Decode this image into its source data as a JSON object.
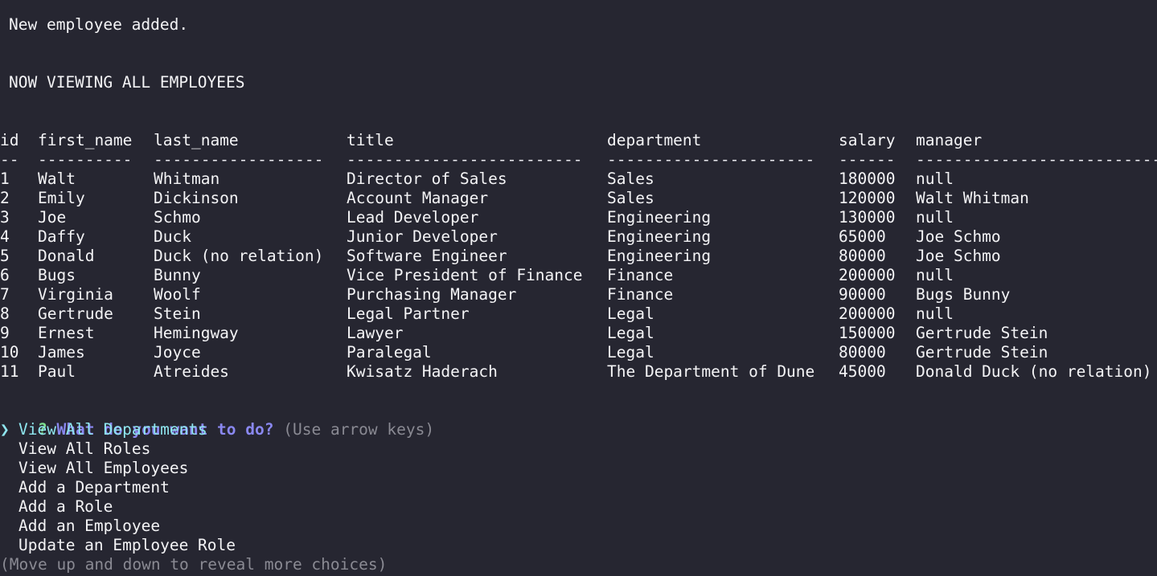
{
  "messages": {
    "added": "New employee added.",
    "viewing": "NOW VIEWING ALL EMPLOYEES"
  },
  "table": {
    "headers": [
      "id",
      "first_name",
      "last_name",
      "title",
      "department",
      "salary",
      "manager"
    ],
    "separators": [
      "--",
      "----------",
      "------------------",
      "-------------------------",
      "----------------------",
      "------",
      "---------------------------"
    ],
    "rows": [
      [
        "1",
        "Walt",
        "Whitman",
        "Director of Sales",
        "Sales",
        "180000",
        "null"
      ],
      [
        "2",
        "Emily",
        "Dickinson",
        "Account Manager",
        "Sales",
        "120000",
        "Walt Whitman"
      ],
      [
        "3",
        "Joe",
        "Schmo",
        "Lead Developer",
        "Engineering",
        "130000",
        "null"
      ],
      [
        "4",
        "Daffy",
        "Duck",
        "Junior Developer",
        "Engineering",
        "65000",
        "Joe Schmo"
      ],
      [
        "5",
        "Donald",
        "Duck (no relation)",
        "Software Engineer",
        "Engineering",
        "80000",
        "Joe Schmo"
      ],
      [
        "6",
        "Bugs",
        "Bunny",
        "Vice President of Finance",
        "Finance",
        "200000",
        "null"
      ],
      [
        "7",
        "Virginia",
        "Woolf",
        "Purchasing Manager",
        "Finance",
        "90000",
        "Bugs Bunny"
      ],
      [
        "8",
        "Gertrude",
        "Stein",
        "Legal Partner",
        "Legal",
        "200000",
        "null"
      ],
      [
        "9",
        "Ernest",
        "Hemingway",
        "Lawyer",
        "Legal",
        "150000",
        "Gertrude Stein"
      ],
      [
        "10",
        "James",
        "Joyce",
        "Paralegal",
        "Legal",
        "80000",
        "Gertrude Stein"
      ],
      [
        "11",
        "Paul",
        "Atreides",
        "Kwisatz Haderach",
        "The Department of Dune",
        "45000",
        "Donald Duck (no relation)"
      ]
    ]
  },
  "prompt": {
    "qmark": "?",
    "question": "What do you want to do?",
    "hint": "(Use arrow keys)",
    "pointer": "❯",
    "choices": [
      "View All Departments",
      "View All Roles",
      "View All Employees",
      "Add a Department",
      "Add a Role",
      "Add an Employee",
      "Update an Employee Role"
    ],
    "more": "(Move up and down to reveal more choices)"
  }
}
